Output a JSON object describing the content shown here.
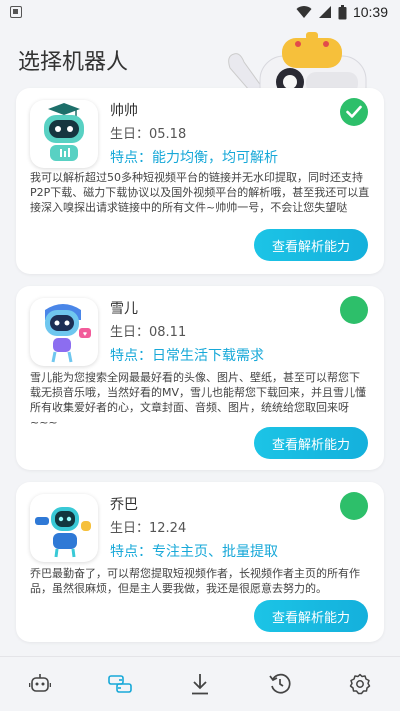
{
  "status_bar": {
    "time": "10:39"
  },
  "page": {
    "title": "选择机器人"
  },
  "bots": [
    {
      "name": "帅帅",
      "birthday": "生日：05.18",
      "feature": "特点：能力均衡，均可解析",
      "description": "我可以解析超过50多种短视频平台的链接并无水印提取，同时还支持P2P下载、磁力下载协议以及国外视频平台的解析哦，甚至我还可以直接深入嗅探出请求链接中的所有文件~帅帅一号，不会让您失望哒",
      "button": "查看解析能力",
      "selected": true,
      "status_color": "#2dbf6a"
    },
    {
      "name": "雪儿",
      "birthday": "生日：08.11",
      "feature": "特点：日常生活下载需求",
      "description": "雪儿能为您搜索全网最最好看的头像、图片、壁纸，甚至可以帮您下载无损音乐哦，当然好看的MV，雪儿也能帮您下载回来，并且雪儿懂所有收集爱好者的心，文章封面、音频、图片，统统给您取回来呀~~~",
      "button": "查看解析能力",
      "selected": false,
      "status_color": "#2dbf6a"
    },
    {
      "name": "乔巴",
      "birthday": "生日：12.24",
      "feature": "特点：专注主页、批量提取",
      "description": "乔巴最勤奋了，可以帮您提取短视频作者，长视频作者主页的所有作品，虽然很麻烦，但是主人要我做，我还是很愿意去努力的。",
      "button": "查看解析能力",
      "selected": false,
      "status_color": "#2dbf6a"
    }
  ],
  "bottom_nav": [
    {
      "icon": "robot-icon",
      "active": false
    },
    {
      "icon": "link-icon",
      "active": true
    },
    {
      "icon": "download-icon",
      "active": false
    },
    {
      "icon": "history-icon",
      "active": false
    },
    {
      "icon": "gear-icon",
      "active": false
    }
  ],
  "colors": {
    "accent": "#17a8d8",
    "button": "#14b0dc",
    "status": "#2dbf6a",
    "background": "#f3f4f7"
  }
}
